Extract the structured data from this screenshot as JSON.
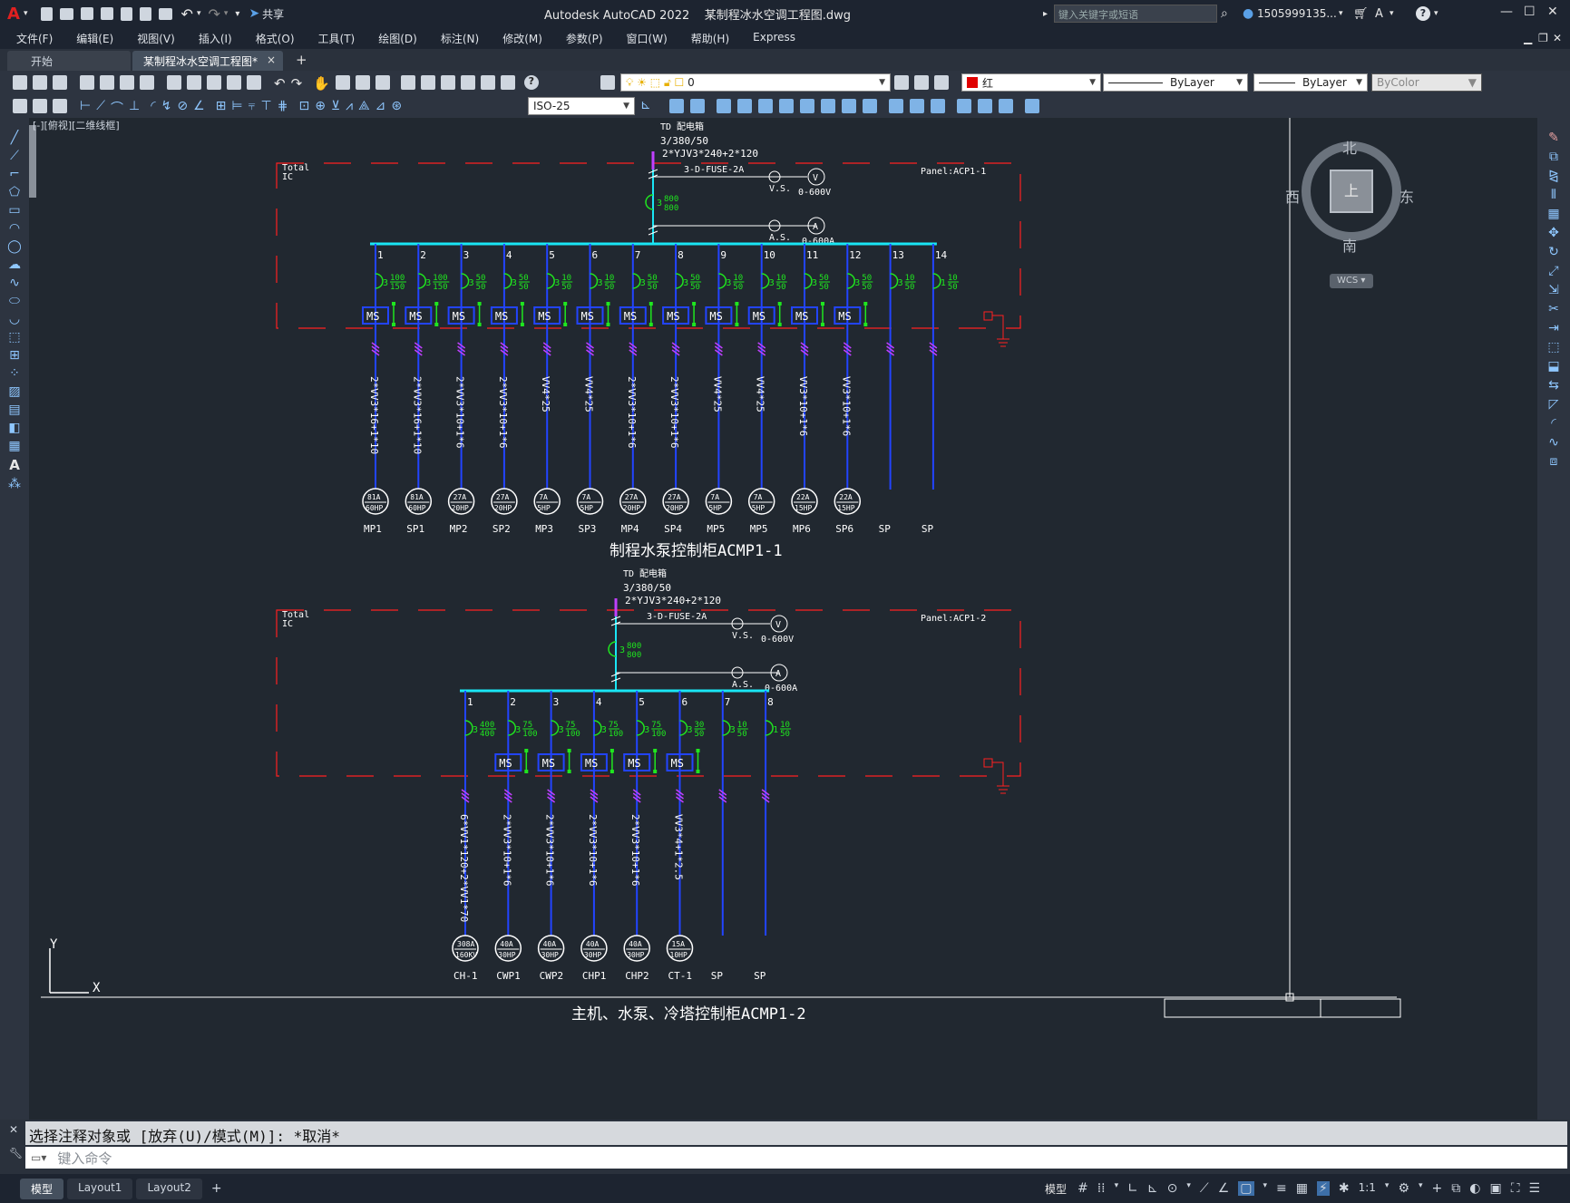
{
  "titlebar": {
    "app_letter": "A",
    "share_label": "共享",
    "title": "Autodesk AutoCAD 2022    某制程冰水空调工程图.dwg",
    "search_placeholder": "键入关键字或短语",
    "user": "1505999135...",
    "help": "?"
  },
  "menu": [
    "文件(F)",
    "编辑(E)",
    "视图(V)",
    "插入(I)",
    "格式(O)",
    "工具(T)",
    "绘图(D)",
    "标注(N)",
    "修改(M)",
    "参数(P)",
    "窗口(W)",
    "帮助(H)",
    "Express"
  ],
  "tabs": {
    "start": "开始",
    "active": "某制程冰水空调工程图*",
    "close": "×",
    "plus": "+"
  },
  "toolbar": {
    "layer_value": "0",
    "color_value": "红",
    "color_hex": "#e00000",
    "linetype_value": "ByLayer",
    "lineweight_value": "ByLayer",
    "plotstyle_value": "ByColor",
    "dimstyle_value": "ISO-25"
  },
  "viewport_label": "[-][俯视][二维线框]",
  "viewcube": {
    "north": "北",
    "south": "南",
    "east": "东",
    "west": "西",
    "top": "上",
    "wcs": "WCS"
  },
  "ucs": {
    "x": "X",
    "y": "Y"
  },
  "panel1": {
    "td_label": "TD 配电箱",
    "voltage": "3/380/50",
    "main_cable": "2*YJV3*240+2*120",
    "fuse": "3-D-FUSE-2A",
    "vs": "V.S.",
    "vm_range": "0-600V",
    "as": "A.S.",
    "am_range": "0-600A",
    "breaker_num": "3",
    "breaker_rating": "800",
    "breaker_frame": "800",
    "panel_name": "Panel:ACP1-1",
    "total_label": "Total",
    "total_sub": "IC",
    "caption": "制程水泵控制柜ACMP1-1",
    "feeders": [
      {
        "num": "1",
        "poles": "3",
        "r1": "100",
        "r2": "150",
        "ms": "MS",
        "cable": "2*VV3*16+1*10",
        "amps": "81A",
        "hp": "60HP",
        "name": "MP1"
      },
      {
        "num": "2",
        "poles": "3",
        "r1": "100",
        "r2": "150",
        "ms": "MS",
        "cable": "2*VV3*16+1*10",
        "amps": "81A",
        "hp": "60HP",
        "name": "SP1"
      },
      {
        "num": "3",
        "poles": "3",
        "r1": "50",
        "r2": "50",
        "ms": "MS",
        "cable": "2*VV3*10+1*6",
        "amps": "27A",
        "hp": "20HP",
        "name": "MP2"
      },
      {
        "num": "4",
        "poles": "3",
        "r1": "50",
        "r2": "50",
        "ms": "MS",
        "cable": "2*VV3*10+1*6",
        "amps": "27A",
        "hp": "20HP",
        "name": "SP2"
      },
      {
        "num": "5",
        "poles": "3",
        "r1": "10",
        "r2": "50",
        "ms": "MS",
        "cable": "VV4*25",
        "amps": "7A",
        "hp": "5HP",
        "name": "MP3"
      },
      {
        "num": "6",
        "poles": "3",
        "r1": "10",
        "r2": "50",
        "ms": "MS",
        "cable": "VV4*25",
        "amps": "7A",
        "hp": "5HP",
        "name": "SP3"
      },
      {
        "num": "7",
        "poles": "3",
        "r1": "50",
        "r2": "50",
        "ms": "MS",
        "cable": "2*VV3*10+1*6",
        "amps": "27A",
        "hp": "20HP",
        "name": "MP4"
      },
      {
        "num": "8",
        "poles": "3",
        "r1": "50",
        "r2": "50",
        "ms": "MS",
        "cable": "2*VV3*10+1*6",
        "amps": "27A",
        "hp": "20HP",
        "name": "SP4"
      },
      {
        "num": "9",
        "poles": "3",
        "r1": "10",
        "r2": "50",
        "ms": "MS",
        "cable": "VV4*25",
        "amps": "7A",
        "hp": "5HP",
        "name": "MP5"
      },
      {
        "num": "10",
        "poles": "3",
        "r1": "10",
        "r2": "50",
        "ms": "MS",
        "cable": "VV4*25",
        "amps": "7A",
        "hp": "5HP",
        "name": "MP5"
      },
      {
        "num": "11",
        "poles": "3",
        "r1": "50",
        "r2": "50",
        "ms": "MS",
        "cable": "VV3*10+1*6",
        "amps": "22A",
        "hp": "15HP",
        "name": "MP6"
      },
      {
        "num": "12",
        "poles": "3",
        "r1": "50",
        "r2": "50",
        "ms": "MS",
        "cable": "VV3*10+1*6",
        "amps": "22A",
        "hp": "15HP",
        "name": "SP6"
      },
      {
        "num": "13",
        "poles": "3",
        "r1": "10",
        "r2": "50",
        "ms": "",
        "cable": "",
        "amps": "",
        "hp": "",
        "name": "SP"
      },
      {
        "num": "14",
        "poles": "1",
        "r1": "10",
        "r2": "50",
        "ms": "",
        "cable": "",
        "amps": "",
        "hp": "",
        "name": "SP"
      }
    ]
  },
  "panel2": {
    "td_label": "TD 配电箱",
    "voltage": "3/380/50",
    "main_cable": "2*YJV3*240+2*120",
    "fuse": "3-D-FUSE-2A",
    "vs": "V.S.",
    "vm_range": "0-600V",
    "as": "A.S.",
    "am_range": "0-600A",
    "breaker_num": "3",
    "breaker_rating": "800",
    "breaker_frame": "800",
    "panel_name": "Panel:ACP1-2",
    "total_label": "Total",
    "total_sub": "IC",
    "caption": "主机、水泵、冷塔控制柜ACMP1-2",
    "feeders": [
      {
        "num": "1",
        "poles": "3",
        "r1": "400",
        "r2": "400",
        "ms": "",
        "cable": "6*VV1*120+2*VV1*70",
        "amps": "308A",
        "hp": "160KV",
        "name": "CH-1"
      },
      {
        "num": "2",
        "poles": "3",
        "r1": "75",
        "r2": "100",
        "ms": "MS",
        "cable": "2*VV3*10+1*6",
        "amps": "40A",
        "hp": "30HP",
        "name": "CWP1"
      },
      {
        "num": "3",
        "poles": "3",
        "r1": "75",
        "r2": "100",
        "ms": "MS",
        "cable": "2*VV3*10+1*6",
        "amps": "40A",
        "hp": "30HP",
        "name": "CWP2"
      },
      {
        "num": "4",
        "poles": "3",
        "r1": "75",
        "r2": "100",
        "ms": "MS",
        "cable": "2*VV3*10+1*6",
        "amps": "40A",
        "hp": "30HP",
        "name": "CHP1"
      },
      {
        "num": "5",
        "poles": "3",
        "r1": "75",
        "r2": "100",
        "ms": "MS",
        "cable": "2*VV3*10+1*6",
        "amps": "40A",
        "hp": "30HP",
        "name": "CHP2"
      },
      {
        "num": "6",
        "poles": "3",
        "r1": "30",
        "r2": "50",
        "ms": "MS",
        "cable": "VV3*4+1*2.5",
        "amps": "15A",
        "hp": "10HP",
        "name": "CT-1"
      },
      {
        "num": "7",
        "poles": "3",
        "r1": "10",
        "r2": "50",
        "ms": "",
        "cable": "",
        "amps": "",
        "hp": "",
        "name": "SP"
      },
      {
        "num": "8",
        "poles": "1",
        "r1": "10",
        "r2": "50",
        "ms": "",
        "cable": "",
        "amps": "",
        "hp": "",
        "name": "SP"
      }
    ]
  },
  "cmdline": {
    "history": "选择注释对象或 [放弃(U)/模式(M)]: *取消*",
    "placeholder": "键入命令"
  },
  "status": {
    "layout_tabs": [
      "模型",
      "Layout1",
      "Layout2"
    ],
    "plus": "+",
    "model_label": "模型",
    "scale": "1:1"
  }
}
